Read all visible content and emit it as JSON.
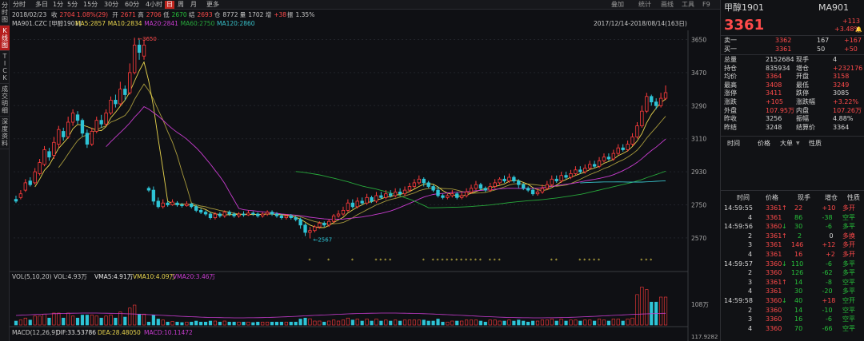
{
  "sidebar": {
    "items": [
      "分时图",
      "K线图",
      "TICK",
      "成交明细",
      "深度资料"
    ],
    "active": 1
  },
  "toolbar": {
    "tabs": [
      "分时",
      "多日",
      "1分",
      "5分",
      "15分",
      "30分",
      "60分",
      "4小时",
      "日",
      "周",
      "月",
      "更多"
    ],
    "selected": 8,
    "right": [
      "叠加",
      "统计",
      "画线",
      "工具",
      "F9"
    ]
  },
  "info": {
    "date": "2018/02/23",
    "close_label": "收",
    "close": "2704",
    "chg": "1.08%(29)",
    "open_label": "开",
    "open": "2671",
    "high_label": "高",
    "high": "2706",
    "low_label": "低",
    "low": "2670",
    "settle_label": "结",
    "settle": "2693",
    "hold_label": "仓",
    "hold": "8772",
    "vol_label": "量",
    "vol": "1702",
    "pos_label": "增",
    "pos": "+38",
    "amp_label": "振",
    "amp": "1.35%"
  },
  "ma": {
    "code": "MA901.CZC [甲醇1901]",
    "items": [
      {
        "label": "MA5:2857",
        "color": "#e8d44d"
      },
      {
        "label": "MA10:2834",
        "color": "#e8d44d"
      },
      {
        "label": "MA20:2841",
        "color": "#c83ccf"
      },
      {
        "label": "MA60:2750",
        "color": "#27a83b"
      },
      {
        "label": "MA120:2860",
        "color": "#37c0c8"
      }
    ]
  },
  "range": "2017/12/14-2018/08/14(163日)",
  "price_axis": [
    "3650",
    "3470",
    "3290",
    "3110",
    "2930",
    "2750",
    "2570"
  ],
  "annot": {
    "high": "3650",
    "low": "2567"
  },
  "vol_info": {
    "title": "VOL(5,10,20) VOL:4.93万",
    "vma5": "VMA5:4.91万",
    "vma10": "VMA10:4.09万",
    "vma20": "VMA20:3.46万",
    "axis_top": "108万",
    "axis_bot": "117.9282"
  },
  "macd_info": {
    "title": "MACD(12,26,9)",
    "dif": "DIF:33.53786",
    "dea": "DEA:28.48050",
    "macd": "MACD:10.11472"
  },
  "colors": {
    "up": "#ff3b3b",
    "down": "#2ec4d6",
    "yellow": "#e8d44d",
    "magenta": "#c83ccf",
    "green": "#27a83b",
    "cyan": "#37c0c8"
  },
  "chart_data": {
    "type": "candlestick",
    "candles": [
      [
        2780,
        2770,
        2800,
        2760
      ],
      [
        2790,
        2810,
        2830,
        2780
      ],
      [
        2830,
        2870,
        2890,
        2820
      ],
      [
        2880,
        2860,
        2900,
        2850
      ],
      [
        2870,
        2930,
        2950,
        2860
      ],
      [
        2920,
        2980,
        3000,
        2910
      ],
      [
        2970,
        3050,
        3070,
        2960
      ],
      [
        3040,
        3010,
        3060,
        2990
      ],
      [
        3020,
        3090,
        3120,
        3000
      ],
      [
        3080,
        3160,
        3180,
        3060
      ],
      [
        3150,
        3120,
        3170,
        3100
      ],
      [
        3120,
        3200,
        3230,
        3110
      ],
      [
        3200,
        3250,
        3270,
        3180
      ],
      [
        3240,
        3210,
        3260,
        3190
      ],
      [
        3210,
        3140,
        3220,
        3120
      ],
      [
        3140,
        3080,
        3160,
        3060
      ],
      [
        3080,
        3150,
        3170,
        3070
      ],
      [
        3150,
        3210,
        3230,
        3140
      ],
      [
        3210,
        3190,
        3240,
        3170
      ],
      [
        3190,
        3250,
        3270,
        3180
      ],
      [
        3250,
        3320,
        3340,
        3240
      ],
      [
        3320,
        3300,
        3350,
        3280
      ],
      [
        3300,
        3380,
        3420,
        3290
      ],
      [
        3380,
        3350,
        3400,
        3320
      ],
      [
        3360,
        3470,
        3520,
        3350
      ],
      [
        3470,
        3620,
        3660,
        3460
      ],
      [
        3620,
        3580,
        3650,
        3540
      ],
      [
        3560,
        3620,
        3650,
        3540
      ],
      [
        2840,
        2830,
        2850,
        2820
      ],
      [
        2830,
        2770,
        2850,
        2750
      ],
      [
        2770,
        2740,
        2790,
        2730
      ],
      [
        2740,
        2760,
        2780,
        2730
      ],
      [
        2760,
        2750,
        2770,
        2740
      ],
      [
        2750,
        2765,
        2780,
        2745
      ],
      [
        2760,
        2750,
        2770,
        2740
      ],
      [
        2750,
        2745,
        2760,
        2735
      ],
      [
        2745,
        2755,
        2770,
        2740
      ],
      [
        2755,
        2740,
        2760,
        2730
      ],
      [
        2740,
        2720,
        2750,
        2710
      ],
      [
        2720,
        2710,
        2730,
        2700
      ],
      [
        2710,
        2700,
        2720,
        2690
      ],
      [
        2700,
        2680,
        2710,
        2670
      ],
      [
        2680,
        2700,
        2710,
        2670
      ],
      [
        2700,
        2690,
        2710,
        2680
      ],
      [
        2690,
        2710,
        2720,
        2680
      ],
      [
        2710,
        2700,
        2720,
        2690
      ],
      [
        2700,
        2690,
        2710,
        2680
      ],
      [
        2690,
        2700,
        2710,
        2680
      ],
      [
        2700,
        2695,
        2715,
        2685
      ],
      [
        2695,
        2705,
        2720,
        2690
      ],
      [
        2705,
        2700,
        2715,
        2690
      ],
      [
        2700,
        2690,
        2710,
        2680
      ],
      [
        2690,
        2700,
        2710,
        2680
      ],
      [
        2700,
        2710,
        2720,
        2690
      ],
      [
        2710,
        2700,
        2720,
        2690
      ],
      [
        2700,
        2690,
        2710,
        2680
      ],
      [
        2690,
        2680,
        2700,
        2670
      ],
      [
        2680,
        2690,
        2700,
        2670
      ],
      [
        2690,
        2680,
        2700,
        2670
      ],
      [
        2680,
        2670,
        2690,
        2660
      ],
      [
        2670,
        2640,
        2680,
        2620
      ],
      [
        2640,
        2600,
        2650,
        2580
      ],
      [
        2600,
        2610,
        2630,
        2567
      ],
      [
        2610,
        2630,
        2640,
        2600
      ],
      [
        2630,
        2650,
        2660,
        2620
      ],
      [
        2650,
        2640,
        2660,
        2630
      ],
      [
        2640,
        2660,
        2670,
        2630
      ],
      [
        2660,
        2690,
        2700,
        2650
      ],
      [
        2690,
        2700,
        2720,
        2680
      ],
      [
        2700,
        2720,
        2740,
        2690
      ],
      [
        2720,
        2760,
        2780,
        2710
      ],
      [
        2760,
        2740,
        2780,
        2730
      ],
      [
        2740,
        2770,
        2790,
        2730
      ],
      [
        2770,
        2760,
        2790,
        2750
      ],
      [
        2760,
        2790,
        2810,
        2750
      ],
      [
        2790,
        2770,
        2800,
        2760
      ],
      [
        2770,
        2800,
        2820,
        2760
      ],
      [
        2800,
        2790,
        2820,
        2780
      ],
      [
        2790,
        2810,
        2830,
        2780
      ],
      [
        2810,
        2800,
        2830,
        2790
      ],
      [
        2800,
        2820,
        2840,
        2790
      ],
      [
        2820,
        2810,
        2840,
        2800
      ],
      [
        2810,
        2830,
        2850,
        2800
      ],
      [
        2830,
        2850,
        2870,
        2820
      ],
      [
        2850,
        2870,
        2890,
        2840
      ],
      [
        2870,
        2890,
        2910,
        2860
      ],
      [
        2890,
        2870,
        2900,
        2850
      ],
      [
        2870,
        2850,
        2880,
        2840
      ],
      [
        2850,
        2830,
        2860,
        2820
      ],
      [
        2830,
        2800,
        2850,
        2790
      ],
      [
        2800,
        2790,
        2810,
        2780
      ],
      [
        2790,
        2800,
        2810,
        2780
      ],
      [
        2800,
        2810,
        2830,
        2790
      ],
      [
        2810,
        2790,
        2820,
        2780
      ],
      [
        2790,
        2800,
        2820,
        2780
      ],
      [
        2800,
        2820,
        2840,
        2790
      ],
      [
        2820,
        2840,
        2860,
        2810
      ],
      [
        2840,
        2860,
        2880,
        2830
      ],
      [
        2860,
        2840,
        2870,
        2830
      ],
      [
        2840,
        2830,
        2850,
        2820
      ],
      [
        2830,
        2850,
        2870,
        2820
      ],
      [
        2850,
        2870,
        2890,
        2840
      ],
      [
        2870,
        2890,
        2900,
        2860
      ],
      [
        2890,
        2880,
        2910,
        2870
      ],
      [
        2880,
        2900,
        2920,
        2870
      ],
      [
        2900,
        2880,
        2910,
        2870
      ],
      [
        2880,
        2860,
        2890,
        2840
      ],
      [
        2860,
        2840,
        2870,
        2830
      ],
      [
        2840,
        2830,
        2850,
        2820
      ],
      [
        2830,
        2810,
        2840,
        2800
      ],
      [
        2810,
        2820,
        2840,
        2800
      ],
      [
        2820,
        2840,
        2860,
        2810
      ],
      [
        2840,
        2860,
        2880,
        2830
      ],
      [
        2860,
        2890,
        2910,
        2850
      ],
      [
        2890,
        2880,
        2910,
        2870
      ],
      [
        2880,
        2910,
        2930,
        2870
      ],
      [
        2910,
        2900,
        2930,
        2890
      ],
      [
        2900,
        2920,
        2940,
        2890
      ],
      [
        2920,
        2940,
        2960,
        2910
      ],
      [
        2940,
        2930,
        2960,
        2920
      ],
      [
        2930,
        2950,
        2970,
        2920
      ],
      [
        2950,
        2970,
        2990,
        2940
      ],
      [
        2970,
        2960,
        2990,
        2950
      ],
      [
        2960,
        2990,
        3010,
        2950
      ],
      [
        2990,
        3010,
        3030,
        2980
      ],
      [
        3010,
        3000,
        3030,
        2990
      ],
      [
        3000,
        3030,
        3050,
        2990
      ],
      [
        3030,
        3060,
        3080,
        3020
      ],
      [
        3060,
        3050,
        3080,
        3040
      ],
      [
        3050,
        3080,
        3100,
        3040
      ],
      [
        3080,
        3120,
        3140,
        3070
      ],
      [
        3120,
        3180,
        3200,
        3110
      ],
      [
        3180,
        3260,
        3290,
        3170
      ],
      [
        3260,
        3340,
        3360,
        3250
      ],
      [
        3340,
        3310,
        3350,
        3290
      ],
      [
        3310,
        3290,
        3330,
        3270
      ],
      [
        3290,
        3330,
        3360,
        3280
      ],
      [
        3330,
        3361,
        3400,
        3320
      ]
    ]
  },
  "quote": {
    "name": "甲醇1901",
    "code": "MA901",
    "price": "3361",
    "chg": "+113",
    "pct": "+3.48%",
    "book": [
      {
        "label": "卖一",
        "price": "3362",
        "vol": "167",
        "chg": "+167"
      },
      {
        "label": "买一",
        "price": "3361",
        "vol": "50",
        "chg": "+50"
      }
    ],
    "stats": [
      [
        "总量",
        "2152684",
        "现手",
        "4"
      ],
      [
        "持仓",
        "835934",
        "增仓",
        "+232176"
      ],
      [
        "均价",
        "3364",
        "开盘",
        "3158"
      ],
      [
        "最高",
        "3408",
        "最低",
        "3249"
      ],
      [
        "涨停",
        "3411",
        "跌停",
        "3085"
      ],
      [
        "涨跌",
        "+105",
        "涨跌幅",
        "+3.22%"
      ],
      [
        "外盘",
        "107.95万",
        "内盘",
        "107.26万"
      ],
      [
        "昨收",
        "3256",
        "振幅",
        "4.88%"
      ],
      [
        "昨结",
        "3248",
        "结算价",
        "3364"
      ]
    ],
    "book_header": [
      "时间",
      "价格",
      "大单",
      "性质"
    ],
    "tick_header": [
      "时间",
      "价格",
      "现手",
      "增仓",
      "性质"
    ],
    "ticks": [
      [
        "14:59:55",
        "3361",
        "↑",
        "22",
        "+10",
        "多开"
      ],
      [
        "4",
        "3361",
        "",
        "86",
        "-38",
        "空平"
      ],
      [
        "14:59:56",
        "3360",
        "↓",
        "30",
        "-6",
        "多平"
      ],
      [
        "2",
        "3361",
        "↑",
        "2",
        "0",
        "多换"
      ],
      [
        "3",
        "3361",
        "",
        "146",
        "+12",
        "多开"
      ],
      [
        "4",
        "3361",
        "",
        "16",
        "+2",
        "多开"
      ],
      [
        "14:59:57",
        "3360",
        "↓",
        "110",
        "-6",
        "多平"
      ],
      [
        "2",
        "3360",
        "",
        "126",
        "-62",
        "多平"
      ],
      [
        "3",
        "3361",
        "↑",
        "14",
        "-8",
        "空平"
      ],
      [
        "4",
        "3361",
        "",
        "30",
        "-20",
        "多平"
      ],
      [
        "14:59:58",
        "3360",
        "↓",
        "40",
        "+18",
        "空开"
      ],
      [
        "2",
        "3360",
        "",
        "14",
        "-10",
        "空平"
      ],
      [
        "3",
        "3360",
        "",
        "16",
        "-6",
        "空平"
      ],
      [
        "4",
        "3360",
        "",
        "70",
        "-66",
        "空平"
      ]
    ]
  }
}
